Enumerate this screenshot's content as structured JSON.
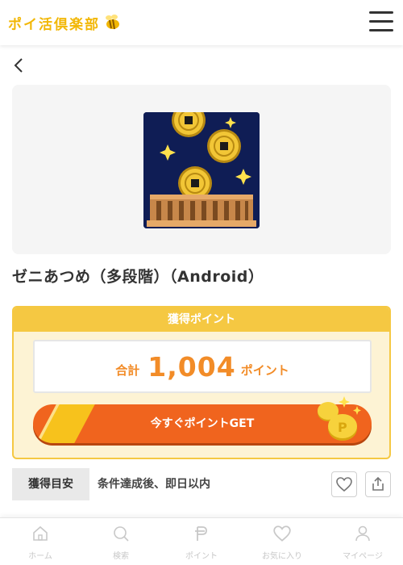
{
  "header": {
    "logo_text": "ポイ活倶楽部",
    "menu_icon": "hamburger-menu-icon",
    "logo_color": "#f2b705"
  },
  "nav": {
    "back_icon": "chevron-left-icon"
  },
  "offer": {
    "title": "ゼニあつめ（多段階）（Android）",
    "image_icon": "coins-and-wooden-box-app-icon"
  },
  "points": {
    "header": "獲得ポイント",
    "total_label": "合計",
    "total_value": "1,004",
    "total_unit": "ポイント",
    "cta_label": "今すぐポイントGET",
    "accent": "#f28c28",
    "header_bg": "#f5c842",
    "button_bg": "#f0641e"
  },
  "estimate": {
    "label": "獲得目安",
    "text": "条件達成後、即日以内",
    "favorite_icon": "heart-icon",
    "share_icon": "share-icon"
  },
  "bottom_nav": [
    {
      "label": "ホーム",
      "icon": "home-icon"
    },
    {
      "label": "検索",
      "icon": "search-icon"
    },
    {
      "label": "ポイント",
      "icon": "point-p-icon"
    },
    {
      "label": "お気に入り",
      "icon": "heart-icon"
    },
    {
      "label": "マイページ",
      "icon": "person-icon"
    }
  ]
}
